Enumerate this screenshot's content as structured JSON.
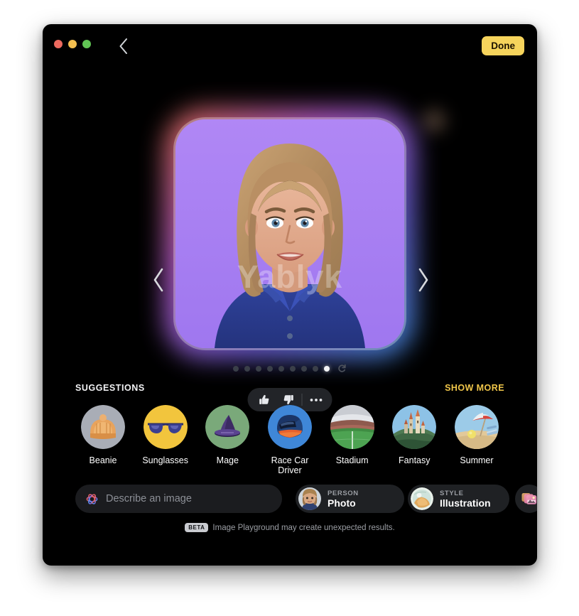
{
  "window": {
    "traffic_lights": [
      "close",
      "minimize",
      "zoom"
    ],
    "back_label": "back-chevron",
    "done_label": "Done"
  },
  "stage": {
    "watermark": "Yablyk",
    "prev_label": "previous-image",
    "next_label": "next-image",
    "pagination": {
      "total": 9,
      "active_index": 8,
      "refresh_label": "regenerate"
    },
    "feedback": {
      "like": "👍",
      "dislike": "👎",
      "more": "•••"
    }
  },
  "suggestions": {
    "title": "SUGGESTIONS",
    "show_more": "SHOW MORE",
    "items": [
      {
        "label": "Beanie",
        "icon": "beanie-icon"
      },
      {
        "label": "Sunglasses",
        "icon": "sunglasses-icon"
      },
      {
        "label": "Mage",
        "icon": "mage-hat-icon"
      },
      {
        "label": "Race Car Driver",
        "icon": "racing-helmet-icon"
      },
      {
        "label": "Stadium",
        "icon": "stadium-icon"
      },
      {
        "label": "Fantasy",
        "icon": "fantasy-castle-icon"
      },
      {
        "label": "Summer",
        "icon": "beach-umbrella-icon"
      }
    ]
  },
  "toolbar": {
    "describe_placeholder": "Describe an image",
    "describe_value": "",
    "person": {
      "key": "PERSON",
      "value": "Photo"
    },
    "style": {
      "key": "STYLE",
      "value": "Illustration"
    },
    "library_label": "photo-library"
  },
  "footer": {
    "badge": "BETA",
    "text": "Image Playground may create unexpected results."
  },
  "colors": {
    "accent_yellow": "#f6d45c",
    "show_more": "#f0c64a",
    "window_bg": "#000000",
    "chip_bg": "#1f2124",
    "canvas_purple": "#a97ef2"
  }
}
